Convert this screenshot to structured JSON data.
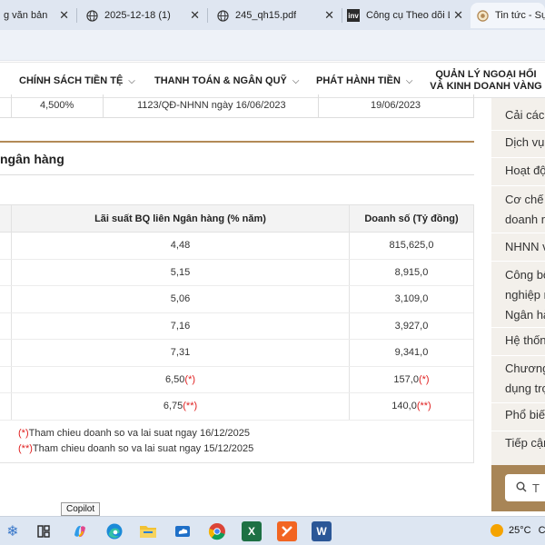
{
  "browser": {
    "tabs": [
      {
        "label": "g văn bản",
        "icon": "document-icon"
      },
      {
        "label": "2025-12-18 (1)",
        "icon": "globe-icon"
      },
      {
        "label": "245_qh15.pdf",
        "icon": "globe-icon"
      },
      {
        "label": "Công cụ Theo dõi Lãi",
        "icon": "inv-logo-icon"
      },
      {
        "label": "Tin tức - Sự ki",
        "icon": "bank-logo-icon"
      }
    ],
    "close_glyph": "✕"
  },
  "nav": {
    "items": [
      {
        "label": "CHÍNH SÁCH TIỀN TỆ"
      },
      {
        "label": "THANH TOÁN & NGÂN QUỸ"
      },
      {
        "label": "PHÁT HÀNH TIỀN"
      },
      {
        "label_line1": "QUẢN LÝ NGOẠI HỐI",
        "label_line2": "VÀ KINH DOANH VÀNG"
      }
    ],
    "chevron": "⌵"
  },
  "upper_table": {
    "rate": "4,500%",
    "decision": "1123/QĐ-NHNN ngày 16/06/2023",
    "effective_date": "19/06/2023"
  },
  "section": {
    "title": "ngân hàng"
  },
  "table": {
    "headers": {
      "rate": "Lãi suất BQ liên Ngân hàng (% năm)",
      "sales": "Doanh số (Tỷ đồng)"
    },
    "rows": [
      {
        "rate": "4,48",
        "sales": "815,625,0",
        "rate_mark": "",
        "sales_mark": ""
      },
      {
        "rate": "5,15",
        "sales": "8,915,0",
        "rate_mark": "",
        "sales_mark": ""
      },
      {
        "rate": "5,06",
        "sales": "3,109,0",
        "rate_mark": "",
        "sales_mark": ""
      },
      {
        "rate": "7,16",
        "sales": "3,927,0",
        "rate_mark": "",
        "sales_mark": ""
      },
      {
        "rate": "7,31",
        "sales": "9,341,0",
        "rate_mark": "",
        "sales_mark": ""
      },
      {
        "rate": "6,50",
        "sales": "157,0",
        "rate_mark": "(*)",
        "sales_mark": "(*)"
      },
      {
        "rate": "6,75",
        "sales": "140,0",
        "rate_mark": "(**)",
        "sales_mark": "(**)"
      }
    ],
    "notes": [
      {
        "mark": "(*)",
        "text": "Tham chieu doanh so va lai suat ngay 16/12/2025"
      },
      {
        "mark": "(**)",
        "text": "Tham chieu doanh so va lai suat ngay 15/12/2025"
      }
    ]
  },
  "sidebar": {
    "items": [
      {
        "lines": [
          "Cải cách"
        ]
      },
      {
        "lines": [
          "Dịch vụ"
        ]
      },
      {
        "lines": [
          "Hoạt độ"
        ]
      },
      {
        "lines": [
          "Cơ chế",
          "doanh n"
        ]
      },
      {
        "lines": [
          "NHNN v"
        ]
      },
      {
        "lines": [
          "Công bố",
          "nghiệp n",
          "Ngân hà"
        ]
      },
      {
        "lines": [
          "Hệ thốn"
        ]
      },
      {
        "lines": [
          "Chương",
          "dụng trọ"
        ]
      },
      {
        "lines": [
          "Phổ biến"
        ]
      },
      {
        "lines": [
          "Tiếp cận"
        ]
      }
    ],
    "search_placeholder": "T"
  },
  "tooltip": "Copilot",
  "taskbar": {
    "temperature": "25°C",
    "weather_suffix": "C"
  },
  "colors": {
    "accent_gold": "#b38a57",
    "sidebar_bg": "#f3f0eb",
    "search_bg": "#a88556",
    "footnote_red": "#e02020"
  }
}
